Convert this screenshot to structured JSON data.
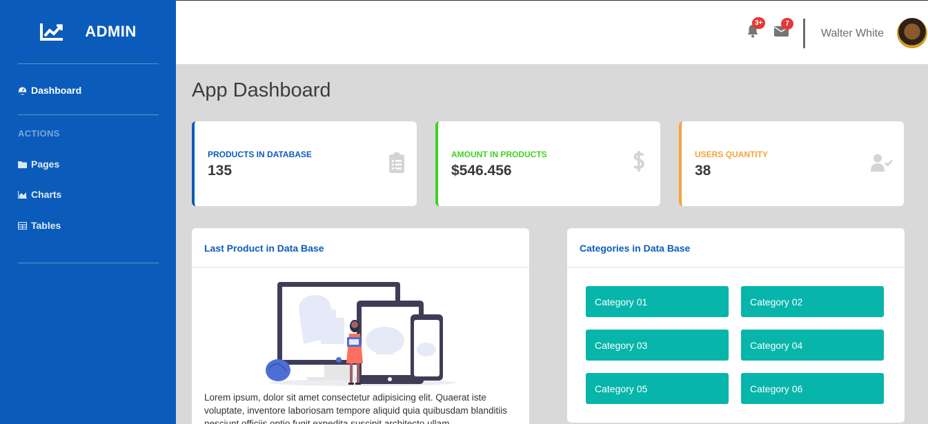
{
  "sidebar": {
    "brand": "ADMIN",
    "nav": {
      "dashboard": "Dashboard",
      "heading": "ACTIONS",
      "pages": "Pages",
      "charts": "Charts",
      "tables": "Tables"
    }
  },
  "topbar": {
    "alerts_badge": "3+",
    "messages_badge": "7",
    "user_name": "Walter White"
  },
  "main": {
    "title": "App Dashboard",
    "stats": [
      {
        "label": "PRODUCTS IN DATABASE",
        "value": "135",
        "color": "#0b5cba",
        "icon": "clipboard-list-icon"
      },
      {
        "label": "AMOUNT IN PRODUCTS",
        "value": "$546.456",
        "color": "#3fd21f",
        "icon": "dollar-icon"
      },
      {
        "label": "USERS QUANTITY",
        "value": "38",
        "color": "#f5a338",
        "icon": "user-check-icon"
      }
    ],
    "last_product": {
      "title": "Last Product in Data Base",
      "text": "Lorem ipsum, dolor sit amet consectetur adipisicing elit. Quaerat iste voluptate, inventore laboriosam tempore aliquid quia quibusdam blanditiis nesciunt officiis optio fugit expedita suscipit architecto ullam"
    },
    "categories": {
      "title": "Categories in Data Base",
      "items": [
        "Category 01",
        "Category 02",
        "Category 03",
        "Category 04",
        "Category 05",
        "Category 06"
      ]
    }
  }
}
